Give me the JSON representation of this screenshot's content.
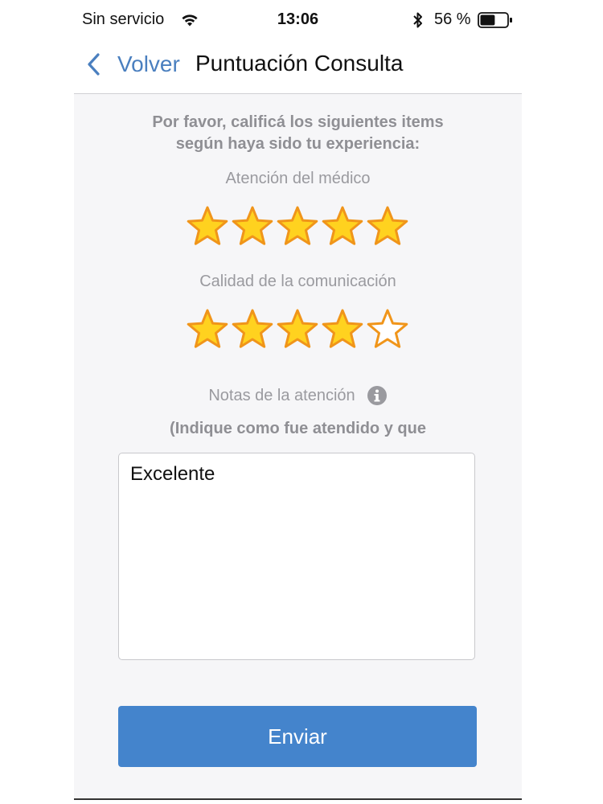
{
  "status_bar": {
    "carrier": "Sin servicio",
    "time": "13:06",
    "battery_percent": "56 %",
    "battery_level": 0.56,
    "icons": [
      "wifi-icon",
      "bluetooth-icon",
      "battery-icon"
    ]
  },
  "nav": {
    "back_label": "Volver",
    "title": "Puntuación Consulta",
    "accent_color": "#4a7fbf"
  },
  "form": {
    "instructions_line1": "Por favor, calificá los siguientes items",
    "instructions_line2": "según haya sido tu experiencia:",
    "ratings": [
      {
        "label": "Atención del médico",
        "value": 5,
        "max": 5
      },
      {
        "label": "Calidad de la comunicación",
        "value": 4,
        "max": 5
      }
    ],
    "notes_label": "Notas de la atención",
    "notes_hint": "(Indique como fue atendido y que",
    "notes_value": "Excelente",
    "submit_label": "Enviar",
    "star_fill_color": "#ffd21f",
    "star_stroke_color": "#f0951a",
    "button_color": "#4484cc"
  }
}
